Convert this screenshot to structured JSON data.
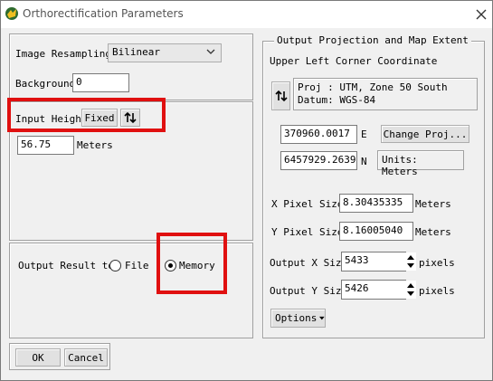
{
  "window": {
    "title": "Orthorectification Parameters"
  },
  "left": {
    "resampling": {
      "label": "Image Resampling",
      "value": "Bilinear"
    },
    "background": {
      "label": "Background",
      "value": "0"
    },
    "height": {
      "label": "Input Height",
      "mode": "Fixed",
      "value": "56.75",
      "unit": "Meters"
    },
    "output": {
      "label": "Output Result to",
      "file_label": "File",
      "memory_label": "Memory",
      "selected": "Memory"
    }
  },
  "right": {
    "group_title": "Output Projection and Map Extent",
    "ulc_label": "Upper Left Corner Coordinate",
    "proj_line1": "Proj : UTM, Zone 50 South",
    "proj_line2": "Datum: WGS-84",
    "easting": "370960.0017",
    "easting_unit": "E",
    "northing": "6457929.2639",
    "northing_unit": "N",
    "change_proj_label": "Change Proj...",
    "units_label": "Units: Meters",
    "x_pixel": {
      "label": "X Pixel Size",
      "value": "8.30435335",
      "unit": "Meters"
    },
    "y_pixel": {
      "label": "Y Pixel Size",
      "value": "8.16005040",
      "unit": "Meters"
    },
    "out_x": {
      "label": "Output X Size",
      "value": "5433",
      "unit": "pixels"
    },
    "out_y": {
      "label": "Output Y Size",
      "value": "5426",
      "unit": "pixels"
    },
    "options_label": "Options"
  },
  "footer": {
    "ok_label": "OK",
    "cancel_label": "Cancel"
  },
  "colors": {
    "highlight": "#e01010",
    "window_bg": "#f0f0f0"
  }
}
